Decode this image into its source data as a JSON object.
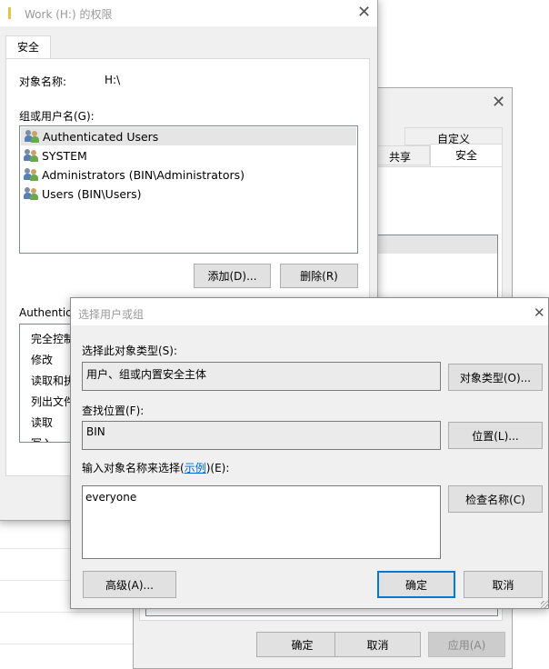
{
  "background": {
    "lines": 4
  },
  "permissions_dialog": {
    "title": "Work (H:) 的权限",
    "close": "✕",
    "tab_security": "安全",
    "object_name_label": "对象名称:",
    "object_name_value": "H:\\",
    "group_label": "组或用户名(G):",
    "users": [
      {
        "name": "Authenticated Users",
        "icon": "users-icon"
      },
      {
        "name": "SYSTEM",
        "icon": "users-icon"
      },
      {
        "name": "Administrators (BIN\\Administrators)",
        "icon": "users-icon"
      },
      {
        "name": "Users (BIN\\Users)",
        "icon": "users-icon"
      }
    ],
    "add_button": "添加(D)...",
    "remove_button": "删除(R)",
    "perm_header": "Authentica",
    "perms": [
      "完全控制",
      "修改",
      "读取和执",
      "列出文件",
      "读取",
      "写入"
    ]
  },
  "properties_dialog": {
    "close": "✕",
    "tab_custom": "自定义",
    "tab_share": "共享",
    "tab_security": "安全",
    "ok_button": "确定",
    "cancel_button": "取消",
    "apply_button": "应用(A)"
  },
  "select_dialog": {
    "title": "选择用户或组",
    "close": "✕",
    "object_type_label": "选择此对象类型(S):",
    "object_type_value": "用户、组或内置安全主体",
    "object_type_button": "对象类型(O)...",
    "location_label": "查找位置(F):",
    "location_value": "BIN",
    "location_button": "位置(L)...",
    "enter_label_prefix": "输入对象名称来选择(",
    "enter_label_link": "示例",
    "enter_label_suffix": ")(E):",
    "names_value": "everyone",
    "check_names_button": "检查名称(C)",
    "advanced_button": "高级(A)...",
    "ok_button": "确定",
    "cancel_button": "取消"
  }
}
